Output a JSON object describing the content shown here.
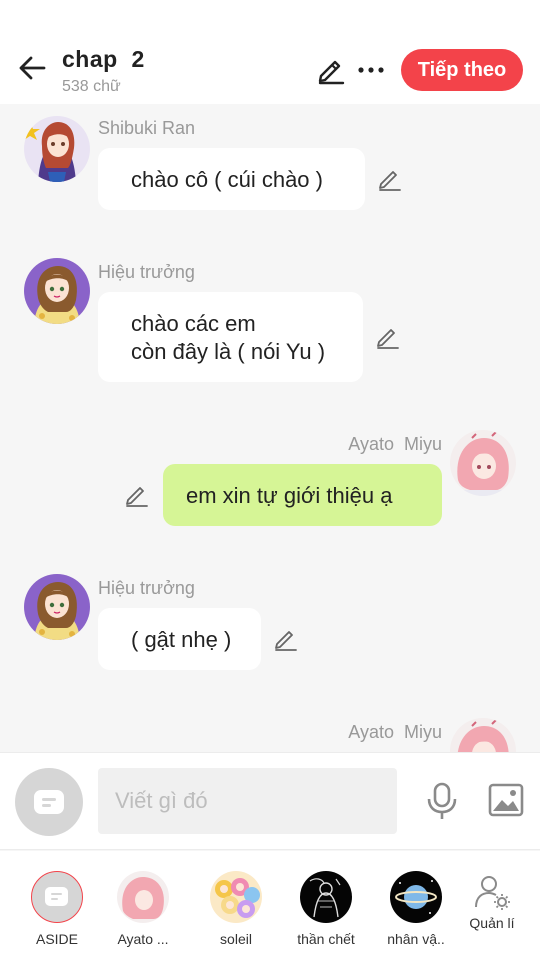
{
  "header": {
    "title": "chap  2",
    "word_count": "538 chữ",
    "next_label": "Tiếp theo",
    "accent_color": "#f3434a"
  },
  "messages": [
    {
      "sender": "Shibuki Ran",
      "text": "chào cô ( cúi chào )",
      "side": "left",
      "avatar_icon": "shibuki-ran-avatar"
    },
    {
      "sender": "Hiệu trưởng",
      "text": "chào các em\ncòn đây là ( nói Yu )",
      "side": "left",
      "avatar_icon": "hieu-truong-avatar"
    },
    {
      "sender": "Ayato  Miyu",
      "text": "em xin tự giới thiệu ạ",
      "side": "right",
      "avatar_icon": "ayato-miyu-avatar"
    },
    {
      "sender": "Hiệu trưởng",
      "text": "( gật nhẹ )",
      "side": "left",
      "avatar_icon": "hieu-truong-avatar"
    },
    {
      "sender": "Ayato  Miyu",
      "text": "",
      "side": "right",
      "avatar_icon": "ayato-miyu-avatar"
    }
  ],
  "composer": {
    "placeholder": "Viết gì đó",
    "mine_bubble_color": "#d6f596"
  },
  "characters": [
    {
      "label": "ASIDE",
      "icon": "aside-icon",
      "selected": true
    },
    {
      "label": "Ayato ...",
      "icon": "ayato-avatar"
    },
    {
      "label": "soleil",
      "icon": "soleil-avatar"
    },
    {
      "label": "thần chết",
      "icon": "than-chet-avatar"
    },
    {
      "label": "nhân vậ..",
      "icon": "nhan-vat-avatar"
    },
    {
      "label": "Quản lí",
      "icon": "manage-user-icon"
    }
  ]
}
